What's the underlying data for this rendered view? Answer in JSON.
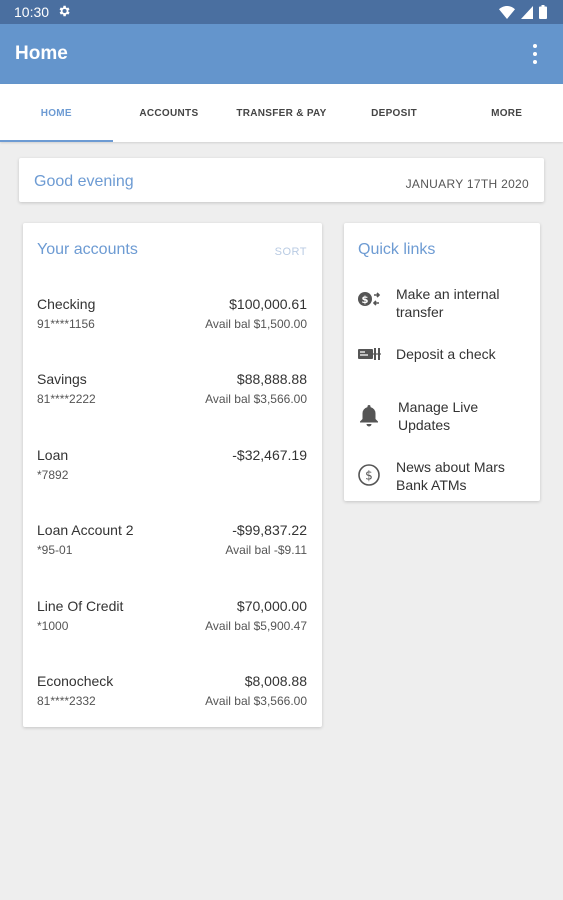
{
  "status": {
    "time": "10:30"
  },
  "app": {
    "title": "Home"
  },
  "tabs": [
    {
      "label": "HOME",
      "active": true
    },
    {
      "label": "ACCOUNTS",
      "active": false
    },
    {
      "label": "TRANSFER & PAY",
      "active": false
    },
    {
      "label": "DEPOSIT",
      "active": false
    },
    {
      "label": "MORE",
      "active": false
    }
  ],
  "greeting": {
    "text": "Good evening",
    "date": "JANUARY 17TH 2020"
  },
  "accounts": {
    "title": "Your accounts",
    "sort_label": "SORT",
    "items": [
      {
        "name": "Checking",
        "number": "91****1156",
        "amount": "$100,000.61",
        "avail": "Avail bal $1,500.00"
      },
      {
        "name": "Savings",
        "number": "81****2222",
        "amount": "$88,888.88",
        "avail": "Avail bal $3,566.00"
      },
      {
        "name": "Loan",
        "number": "*7892",
        "amount": "-$32,467.19",
        "avail": ""
      },
      {
        "name": "Loan Account 2",
        "number": "*95-01",
        "amount": "-$99,837.22",
        "avail": "Avail bal -$9.11"
      },
      {
        "name": "Line Of Credit",
        "number": "*1000",
        "amount": "$70,000.00",
        "avail": "Avail bal $5,900.47"
      },
      {
        "name": "Econocheck",
        "number": "81****2332",
        "amount": "$8,008.88",
        "avail": "Avail bal $3,566.00"
      }
    ]
  },
  "quick_links": {
    "title": "Quick links",
    "items": [
      {
        "label": "Make an internal transfer",
        "icon": "transfer-icon"
      },
      {
        "label": "Deposit a check",
        "icon": "check-deposit-icon"
      },
      {
        "label": "Manage Live Updates",
        "icon": "bell-icon"
      },
      {
        "label": "News about Mars Bank ATMs",
        "icon": "dollar-circle-icon"
      }
    ]
  },
  "colors": {
    "status_bar": "#4a6fa0",
    "app_bar": "#6495cc",
    "accent": "#6d9bd3",
    "background": "#eeeeee"
  }
}
